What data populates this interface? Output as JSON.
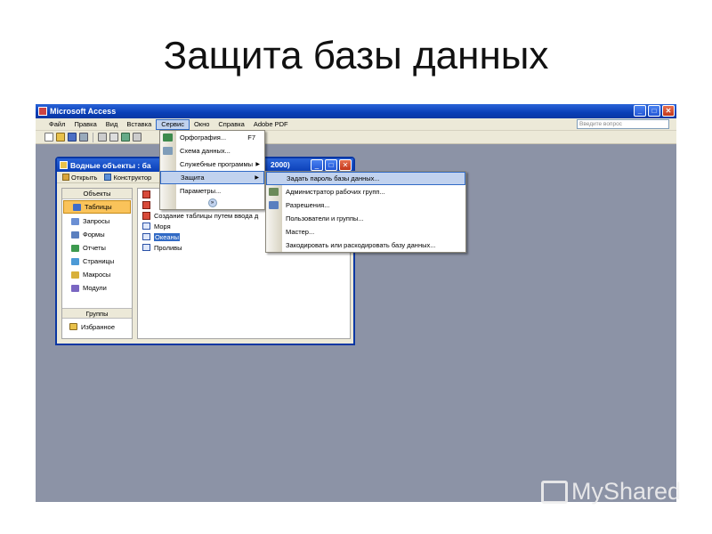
{
  "slide": {
    "title": "Защита базы данных"
  },
  "app": {
    "title": "Microsoft Access",
    "help_placeholder": "Введите вопрос",
    "win_min": "_",
    "win_max": "□",
    "win_close": "✕"
  },
  "menubar": {
    "items": [
      "Файл",
      "Правка",
      "Вид",
      "Вставка",
      "Сервис",
      "Окно",
      "Справка",
      "Adobe PDF"
    ],
    "active": "Сервис"
  },
  "db_window": {
    "title": "Водные объекты : ба",
    "title_suffix": "2000)",
    "toolbar": {
      "open": "Открыть",
      "design": "Конструктор"
    },
    "objects_header": "Объекты",
    "objects": [
      "Таблицы",
      "Запросы",
      "Формы",
      "Отчеты",
      "Страницы",
      "Макросы",
      "Модули"
    ],
    "selected_object": "Таблицы",
    "groups_header": "Группы",
    "favorites": "Избранное",
    "list": [
      "",
      "",
      "Создание таблицы путем ввода д",
      "Моря",
      "Океаны",
      "Проливы"
    ],
    "selected_list_item": "Океаны"
  },
  "service_menu": {
    "items": [
      {
        "label": "Орфография...",
        "shortcut": "F7"
      },
      {
        "label": "Схема данных..."
      },
      {
        "label": "Служебные программы",
        "submenu": true
      },
      {
        "label": "Защита",
        "submenu": true,
        "highlighted": true
      },
      {
        "label": "Параметры..."
      }
    ],
    "chevron": "»"
  },
  "security_submenu": {
    "items": [
      "Задать пароль базы данных...",
      "Администратор рабочих групп...",
      "Разрешения...",
      "Пользователи и группы...",
      "Мастер...",
      "Закодировать или раскодировать базу данных..."
    ]
  },
  "watermark": {
    "text": "MyShared"
  },
  "colors": {
    "workspace": "#8c93a6",
    "titlebar": "#0a3fb7",
    "menu_highlight": "#c1d2ee",
    "selection": "#316ac5",
    "objbar_selected": "#fac35a"
  }
}
